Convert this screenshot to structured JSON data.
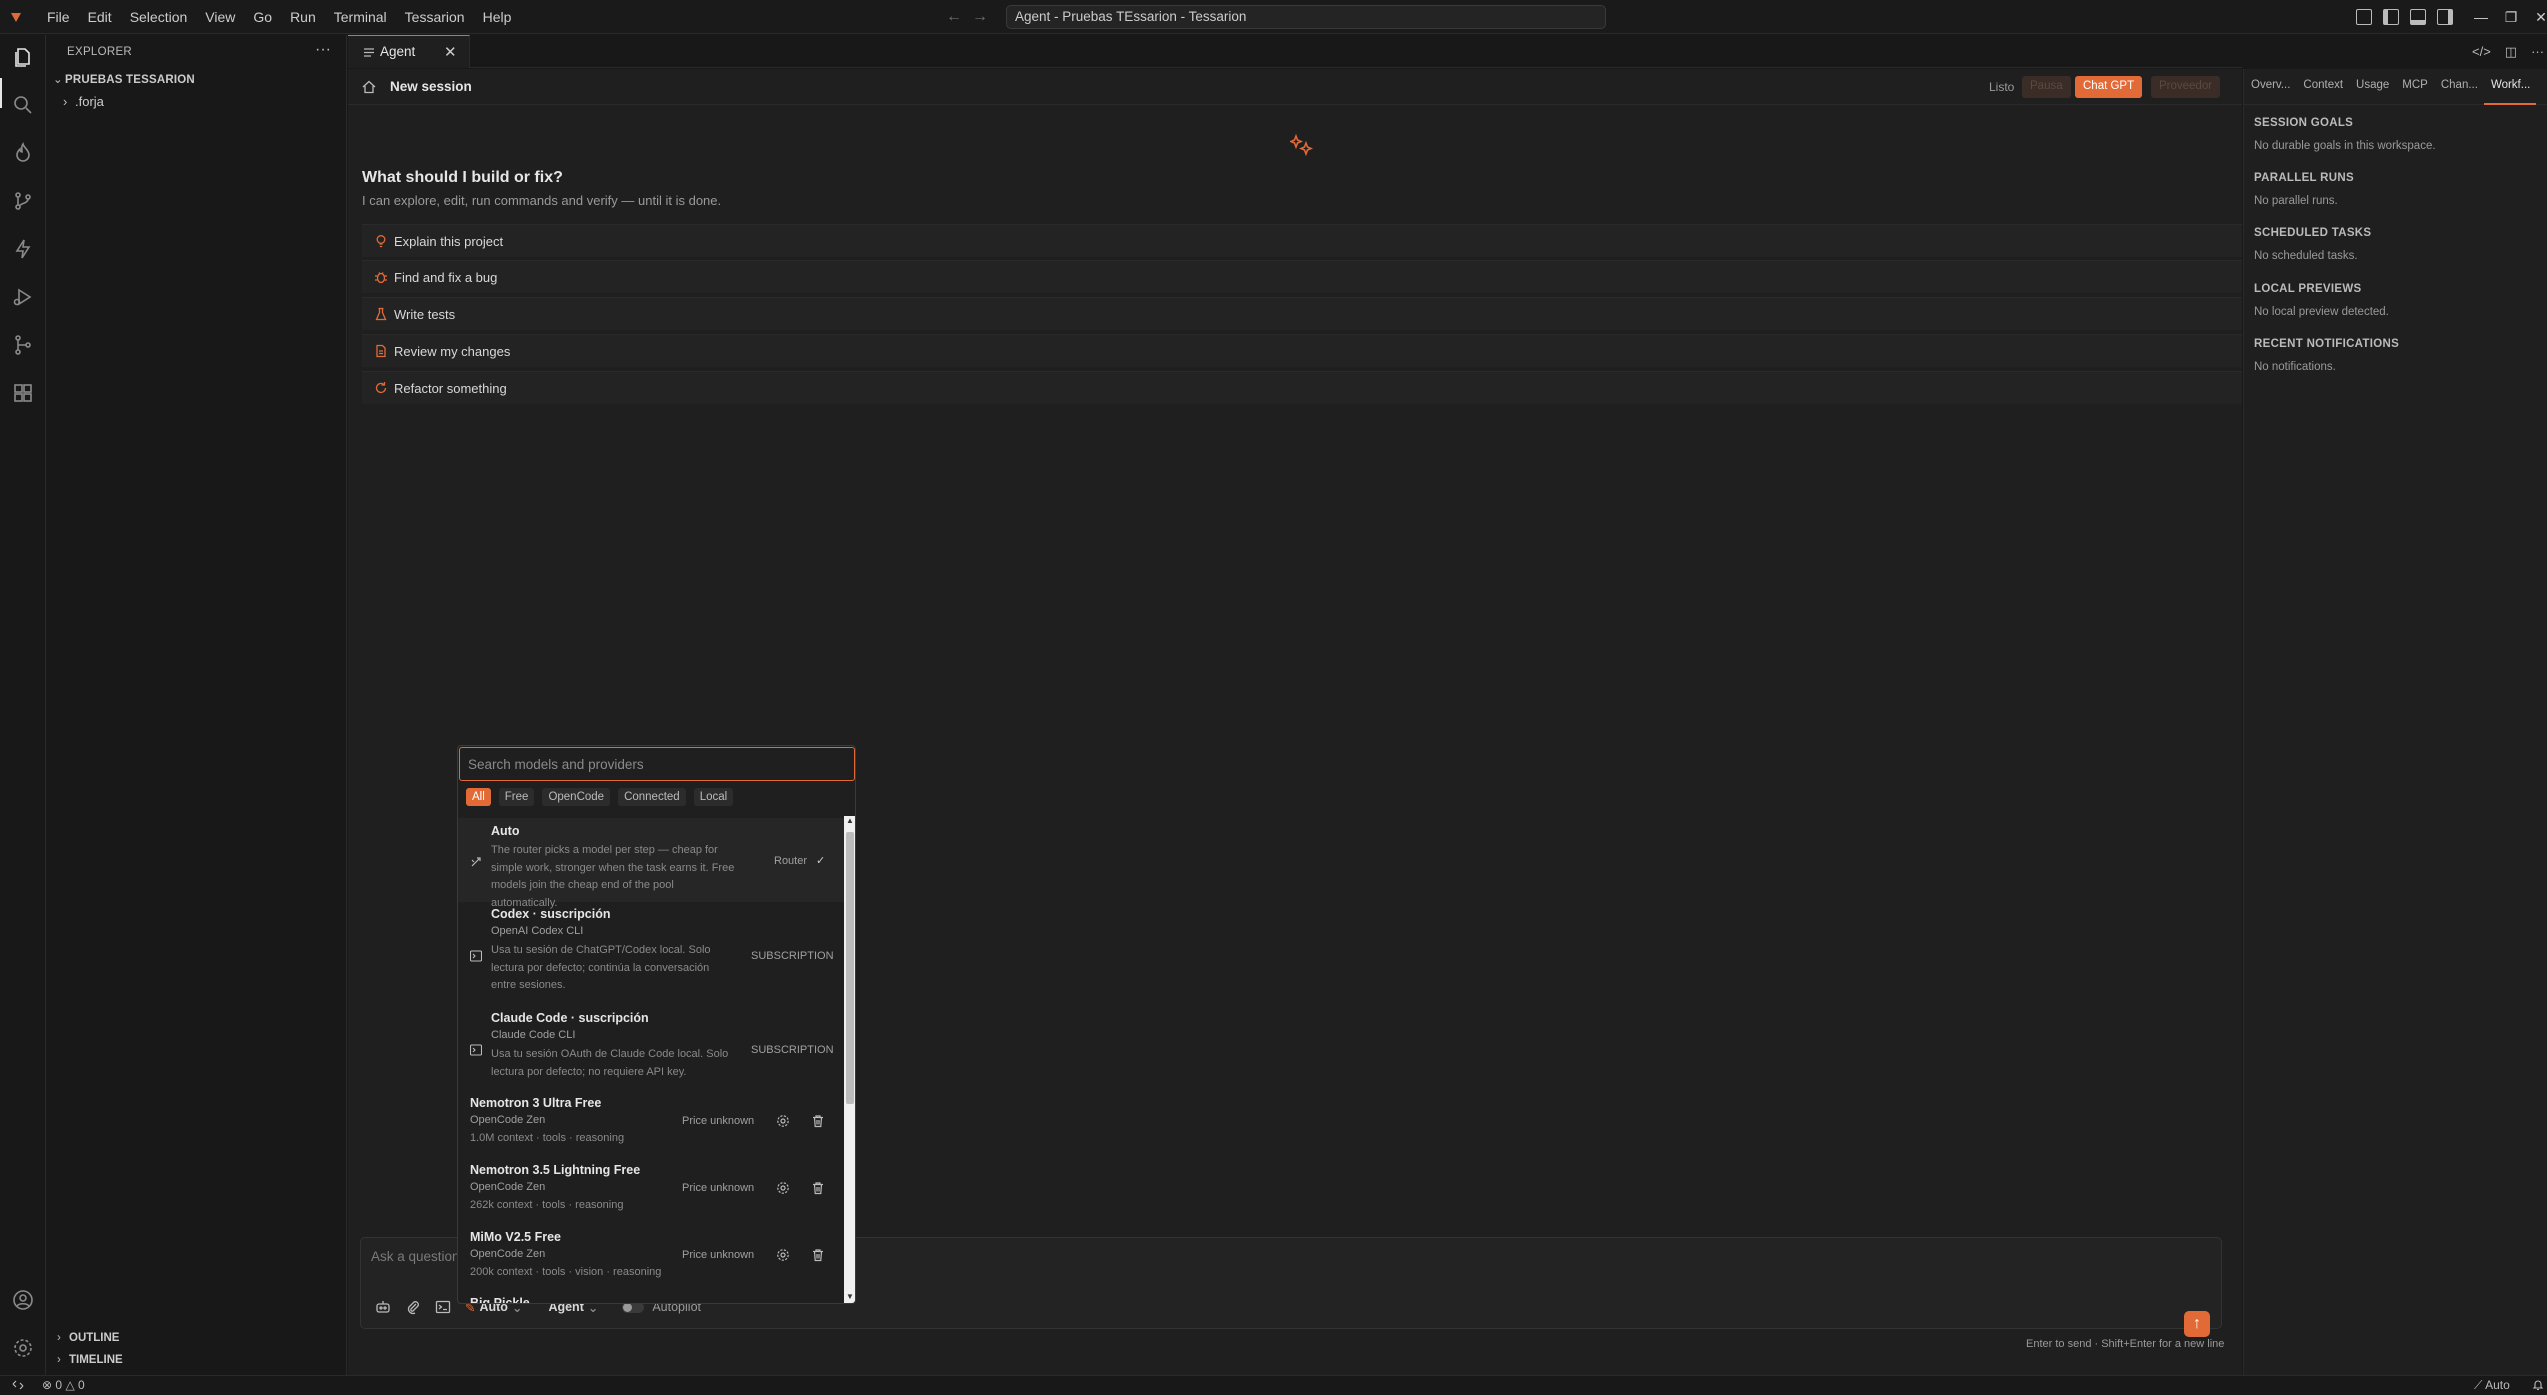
{
  "window": {
    "title": "Agent - Pruebas TEssarion - Tessarion"
  },
  "menu": [
    "File",
    "Edit",
    "Selection",
    "View",
    "Go",
    "Run",
    "Terminal",
    "Tessarion",
    "Help"
  ],
  "sidebar": {
    "title": "EXPLORER",
    "workspace": "PRUEBAS TESSARION",
    "items": [
      ".forja"
    ],
    "outline": "OUTLINE",
    "timeline": "TIMELINE"
  },
  "editor": {
    "tab_label": "Agent"
  },
  "agent": {
    "session_title": "New session",
    "status": "Listo",
    "buttons": {
      "pause": "Pausa",
      "chatgpt": "Chat GPT",
      "third": "Proveedor"
    },
    "hero_title": "What should I build or fix?",
    "hero_subtitle": "I can explore, edit, run commands and verify — until it is done.",
    "suggestions": [
      "Explain this project",
      "Find and fix a bug",
      "Write tests",
      "Review my changes",
      "Refactor something"
    ],
    "composer": {
      "placeholder": "Ask a question",
      "model": "Auto",
      "mode": "Agent",
      "autopilot": "Autopilot",
      "hint": "Enter to send · Shift+Enter for a new line"
    }
  },
  "model_picker": {
    "search_placeholder": "Search models and providers",
    "filters": [
      "All",
      "Free",
      "OpenCode",
      "Connected",
      "Local"
    ],
    "active_filter": "All",
    "models": [
      {
        "name": "Auto",
        "description": "The router picks a model per step — cheap for simple work, stronger when the task earns it. Free models join the cheap end of the pool automatically.",
        "tag": "Router",
        "check": "✓"
      },
      {
        "name": "Codex · suscripción",
        "provider": "OpenAI Codex CLI",
        "description": "Usa tu sesión de ChatGPT/Codex local. Solo lectura por defecto; continúa la conversación entre sesiones.",
        "tag": "SUBSCRIPTION"
      },
      {
        "name": "Claude Code · suscripción",
        "provider": "Claude Code CLI",
        "description": "Usa tu sesión OAuth de Claude Code local. Solo lectura por defecto; no requiere API key.",
        "tag": "SUBSCRIPTION"
      },
      {
        "name": "Nemotron 3 Ultra Free",
        "provider": "OpenCode Zen",
        "meta": "1.0M context · tools · reasoning",
        "price": "Price unknown"
      },
      {
        "name": "Nemotron 3.5 Lightning Free",
        "provider": "OpenCode Zen",
        "meta": "262k context · tools · reasoning",
        "price": "Price unknown"
      },
      {
        "name": "MiMo V2.5 Free",
        "provider": "OpenCode Zen",
        "meta": "200k context · tools · vision · reasoning",
        "price": "Price unknown"
      },
      {
        "name": "Big Pickle"
      }
    ]
  },
  "right_panel": {
    "tabs": [
      "Overv...",
      "Context",
      "Usage",
      "MCP",
      "Chan...",
      "Workf..."
    ],
    "active_tab": "Workf...",
    "sections": [
      {
        "title": "SESSION GOALS",
        "body": "No durable goals in this workspace."
      },
      {
        "title": "PARALLEL RUNS",
        "body": "No parallel runs."
      },
      {
        "title": "SCHEDULED TASKS",
        "body": "No scheduled tasks."
      },
      {
        "title": "LOCAL PREVIEWS",
        "body": "No local preview detected."
      },
      {
        "title": "RECENT NOTIFICATIONS",
        "body": "No notifications."
      }
    ]
  },
  "statusbar": {
    "errors": "0",
    "warnings": "0",
    "auto": "Auto"
  },
  "colors": {
    "accent": "#e26a36",
    "background": "#1f1f1f",
    "chrome": "#181818"
  }
}
